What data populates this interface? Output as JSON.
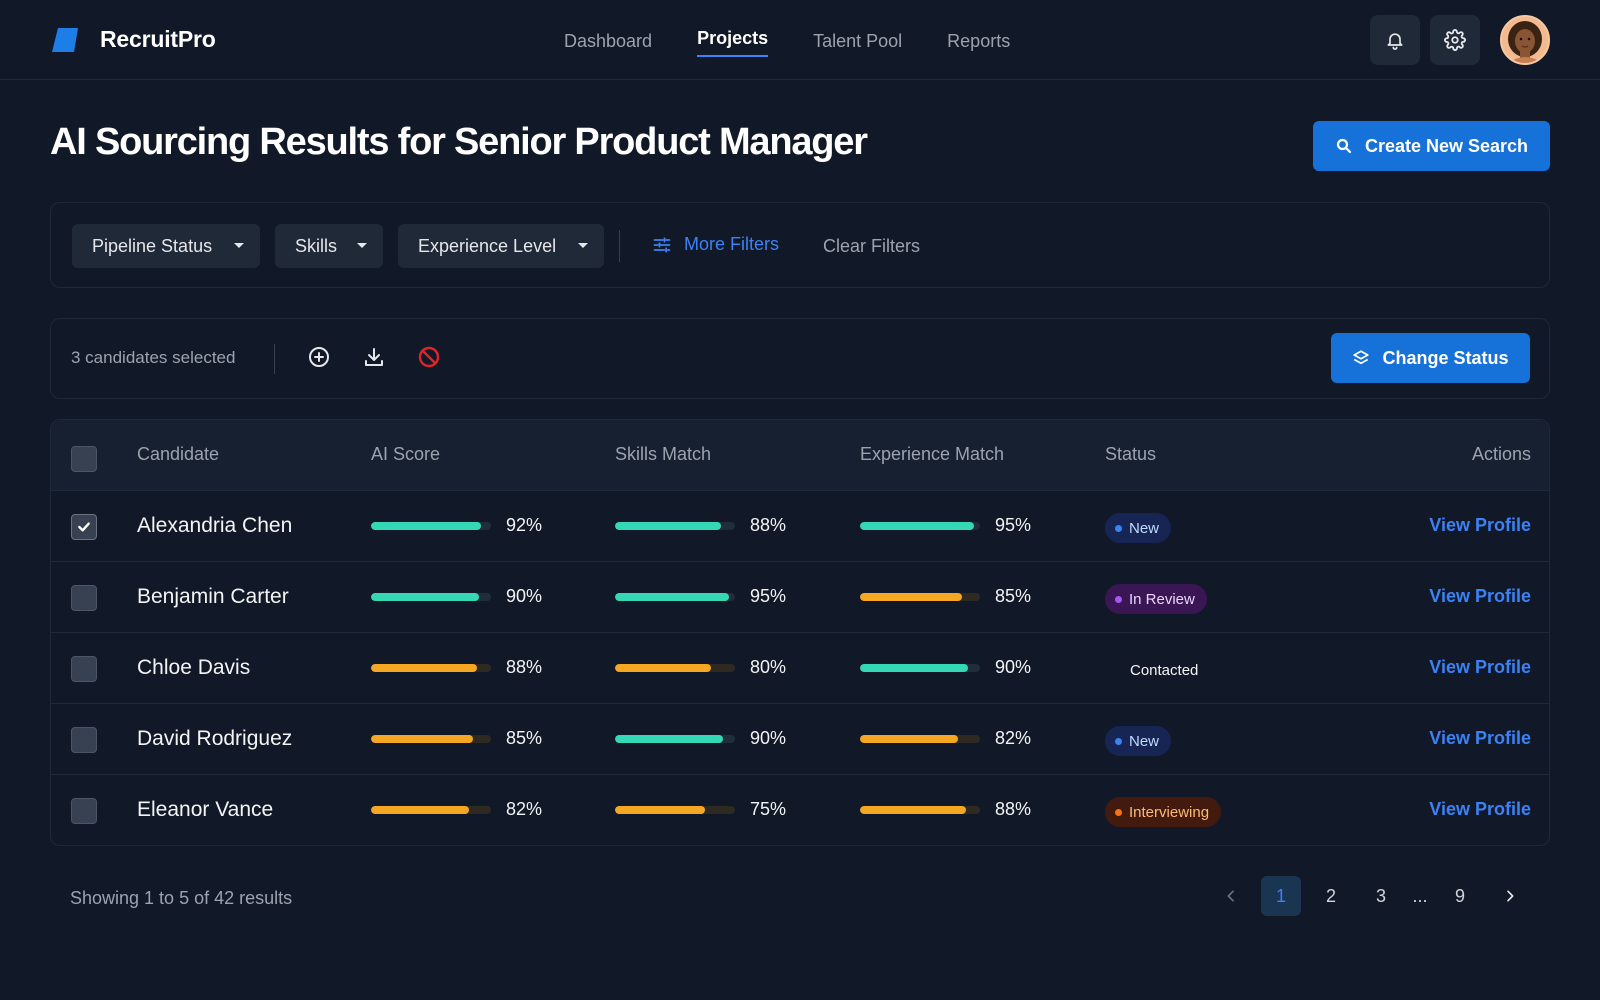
{
  "header": {
    "brand": "RecruitPro",
    "nav": [
      {
        "label": "Dashboard",
        "active": false
      },
      {
        "label": "Projects",
        "active": true
      },
      {
        "label": "Talent Pool",
        "active": false
      },
      {
        "label": "Reports",
        "active": false
      }
    ],
    "icons": [
      "bell-icon",
      "gear-icon"
    ]
  },
  "page": {
    "title": "AI Sourcing Results for Senior Product Manager",
    "create_button": "Create New Search"
  },
  "filters": {
    "dropdowns": [
      "Pipeline Status",
      "Skills",
      "Experience Level"
    ],
    "more_filters": "More Filters",
    "clear_filters": "Clear Filters"
  },
  "selection": {
    "text": "3 candidates selected",
    "actions": [
      "add-circle-icon",
      "download-icon",
      "block-icon"
    ],
    "change_status": "Change Status"
  },
  "table": {
    "columns": [
      "Candidate",
      "AI Score",
      "Skills Match",
      "Experience Match",
      "Status",
      "Actions"
    ],
    "rows": [
      {
        "name": "Alexandria Chen",
        "checked": true,
        "ai": "92%",
        "skills": "88%",
        "exp": "95%",
        "status": "New",
        "action": "View Profile"
      },
      {
        "name": "Benjamin Carter",
        "checked": false,
        "ai": "90%",
        "skills": "95%",
        "exp": "85%",
        "status": "In Review",
        "action": "View Profile"
      },
      {
        "name": "Chloe Davis",
        "checked": false,
        "ai": "88%",
        "skills": "80%",
        "exp": "90%",
        "status": "Contacted",
        "action": "View Profile"
      },
      {
        "name": "David Rodriguez",
        "checked": false,
        "ai": "85%",
        "skills": "90%",
        "exp": "82%",
        "status": "New",
        "action": "View Profile"
      },
      {
        "name": "Eleanor Vance",
        "checked": false,
        "ai": "82%",
        "skills": "75%",
        "exp": "88%",
        "status": "Interviewing",
        "action": "View Profile"
      }
    ]
  },
  "pagination": {
    "summary": "Showing 1 to 5 of 42 results",
    "pages": [
      "1",
      "2",
      "3",
      "...",
      "9"
    ],
    "current": "1"
  },
  "colors": {
    "accent": "#1672d8",
    "link": "#3b82f6",
    "bar_high": "#34d8b4",
    "bar_mid": "#f5a623",
    "status_new": "#3b82f6",
    "status_review": "#a855f7",
    "status_interviewing": "#f97316",
    "danger": "#dc2626"
  }
}
